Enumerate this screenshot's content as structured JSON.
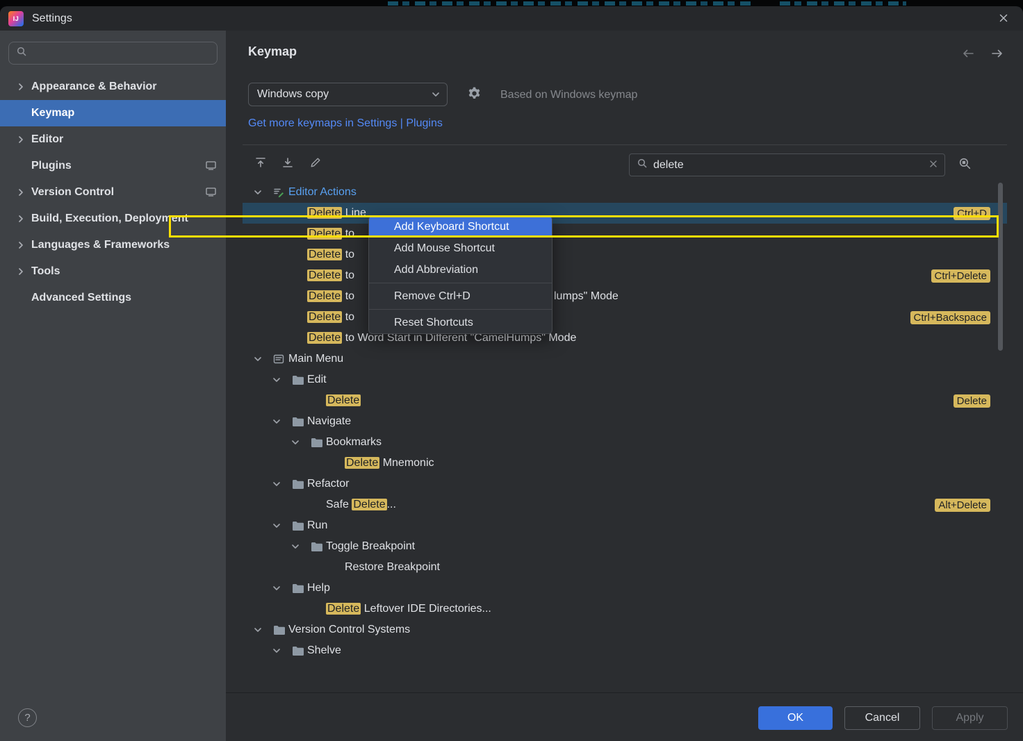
{
  "window": {
    "title": "Settings",
    "logo_text": "IJ"
  },
  "sidebar": {
    "search_placeholder": "",
    "items": [
      {
        "id": "appearance-behavior",
        "label": "Appearance & Behavior",
        "chevron": true
      },
      {
        "id": "keymap",
        "label": "Keymap",
        "selected": true
      },
      {
        "id": "editor",
        "label": "Editor",
        "chevron": true
      },
      {
        "id": "plugins",
        "label": "Plugins",
        "trailing_icon": true
      },
      {
        "id": "version-control",
        "label": "Version Control",
        "chevron": true,
        "trailing_icon": true
      },
      {
        "id": "build-execution-deployment",
        "label": "Build, Execution, Deployment",
        "chevron": true
      },
      {
        "id": "languages-frameworks",
        "label": "Languages & Frameworks",
        "chevron": true
      },
      {
        "id": "tools",
        "label": "Tools",
        "chevron": true
      },
      {
        "id": "advanced-settings",
        "label": "Advanced Settings"
      }
    ]
  },
  "header": {
    "title": "Keymap"
  },
  "scheme": {
    "selected": "Windows copy",
    "based_on": "Based on Windows keymap",
    "more_link": "Get more keymaps in Settings | Plugins"
  },
  "search": {
    "value": "delete"
  },
  "tree": {
    "rows": [
      {
        "level": 0,
        "expanded": true,
        "icon": "editor-actions",
        "label_color": "blue",
        "parts": [
          {
            "t": "Editor Actions"
          }
        ]
      },
      {
        "level": 1,
        "selected": true,
        "parts": [
          {
            "t": "Delete",
            "h": true
          },
          {
            "t": " Line"
          }
        ],
        "shortcut": "Ctrl+D"
      },
      {
        "level": 1,
        "parts": [
          {
            "t": "Delete",
            "h": true
          },
          {
            "t": " to"
          }
        ]
      },
      {
        "level": 1,
        "parts": [
          {
            "t": "Delete",
            "h": true
          },
          {
            "t": " to"
          }
        ]
      },
      {
        "level": 1,
        "parts": [
          {
            "t": "Delete",
            "h": true
          },
          {
            "t": " to"
          }
        ],
        "shortcut": "Ctrl+Delete"
      },
      {
        "level": 1,
        "parts": [
          {
            "t": "Delete",
            "h": true
          },
          {
            "t": " to"
          }
        ],
        "fragment": "lumps\" Mode"
      },
      {
        "level": 1,
        "parts": [
          {
            "t": "Delete",
            "h": true
          },
          {
            "t": " to"
          }
        ],
        "shortcut": "Ctrl+Backspace"
      },
      {
        "level": 1,
        "parts": [
          {
            "t": "Delete",
            "h": true
          },
          {
            "t": " to Word Start in Different \"CamelHumps\" Mode"
          }
        ]
      },
      {
        "level": 0,
        "expanded": true,
        "icon": "main-menu",
        "parts": [
          {
            "t": "Main Menu"
          }
        ]
      },
      {
        "level": 1,
        "expanded": true,
        "icon": "folder",
        "parts": [
          {
            "t": "Edit"
          }
        ]
      },
      {
        "level": 2,
        "parts": [
          {
            "t": "Delete",
            "h": true
          }
        ],
        "shortcut": "Delete"
      },
      {
        "level": 1,
        "expanded": true,
        "icon": "folder",
        "parts": [
          {
            "t": "Navigate"
          }
        ]
      },
      {
        "level": 2,
        "expanded": true,
        "icon": "folder",
        "parts": [
          {
            "t": "Bookmarks"
          }
        ]
      },
      {
        "level": 3,
        "parts": [
          {
            "t": "Delete",
            "h": true
          },
          {
            "t": " Mnemonic"
          }
        ]
      },
      {
        "level": 1,
        "expanded": true,
        "icon": "folder",
        "parts": [
          {
            "t": "Refactor"
          }
        ]
      },
      {
        "level": 2,
        "parts": [
          {
            "t": "Safe "
          },
          {
            "t": "Delete",
            "h": true
          },
          {
            "t": "..."
          }
        ],
        "shortcut": "Alt+Delete"
      },
      {
        "level": 1,
        "expanded": true,
        "icon": "folder",
        "parts": [
          {
            "t": "Run"
          }
        ]
      },
      {
        "level": 2,
        "expanded": true,
        "icon": "folder",
        "parts": [
          {
            "t": "Toggle Breakpoint"
          }
        ]
      },
      {
        "level": 3,
        "parts": [
          {
            "t": "Restore Breakpoint"
          }
        ]
      },
      {
        "level": 1,
        "expanded": true,
        "icon": "folder",
        "parts": [
          {
            "t": "Help"
          }
        ]
      },
      {
        "level": 2,
        "parts": [
          {
            "t": "Delete",
            "h": true
          },
          {
            "t": " Leftover IDE Directories..."
          }
        ]
      },
      {
        "level": 0,
        "expanded": true,
        "icon": "folder",
        "parts": [
          {
            "t": "Version Control Systems"
          }
        ]
      },
      {
        "level": 1,
        "expanded": true,
        "icon": "folder",
        "parts": [
          {
            "t": "Shelve"
          }
        ]
      }
    ]
  },
  "context_menu": {
    "items": [
      {
        "label": "Add Keyboard Shortcut",
        "highlighted": true
      },
      {
        "label": "Add Mouse Shortcut"
      },
      {
        "label": "Add Abbreviation"
      },
      {
        "separator": true
      },
      {
        "label": "Remove Ctrl+D"
      },
      {
        "separator": true
      },
      {
        "label": "Reset Shortcuts"
      }
    ]
  },
  "footer": {
    "help": "?",
    "ok": "OK",
    "cancel": "Cancel",
    "apply": "Apply",
    "apply_enabled": false
  },
  "colors": {
    "accent_blue": "#3574F0",
    "sidebar_selection": "#3C6DB4",
    "tree_selection": "#26475E",
    "menu_highlight": "#3D70D8",
    "match_highlight": "#D6B85C",
    "annotation": "#FFDF00",
    "link": "#548AF7"
  }
}
